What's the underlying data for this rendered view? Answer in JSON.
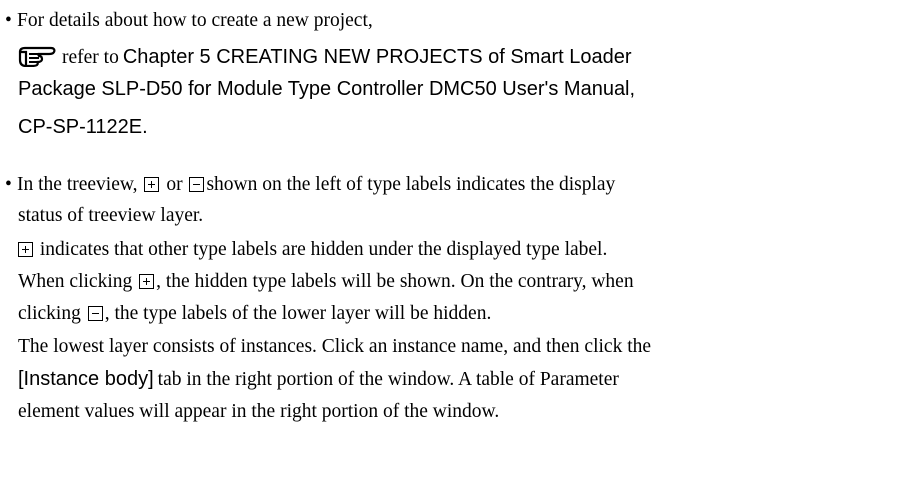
{
  "note1": {
    "bullet": "•",
    "line1": "For details about how to create a new project,",
    "refer_icon": "pointing-hand-icon",
    "refer_prefix": "refer to",
    "ref_line1": "Chapter 5 CREATING NEW PROJECTS of Smart Loader",
    "ref_line2": "Package SLP-D50 for Module Type Controller DMC50 User's Manual,",
    "ref_line3": "CP-SP-1122E."
  },
  "note2": {
    "bullet": "•",
    "l1_a": "In the treeview,",
    "l1_b": "or",
    "l1_c": "shown on the left of type labels indicates the display",
    "l2": "status of treeview layer.",
    "l3": "indicates that other type labels are hidden under the displayed type label.",
    "l4_a": "When clicking",
    "l4_b": ", the hidden type labels will be shown. On the contrary, when",
    "l5_a": "clicking",
    "l5_b": ", the type labels of the lower layer will be hidden.",
    "l6": "The lowest layer consists of instances. Click an instance name, and then click the",
    "l7_a": "[Instance body]",
    "l7_b": "tab in the right portion of the window. A table of Parameter",
    "l8": "element values will appear in the right portion of the window."
  },
  "icons": {
    "expand": "expand-box-icon",
    "collapse": "collapse-box-icon"
  }
}
